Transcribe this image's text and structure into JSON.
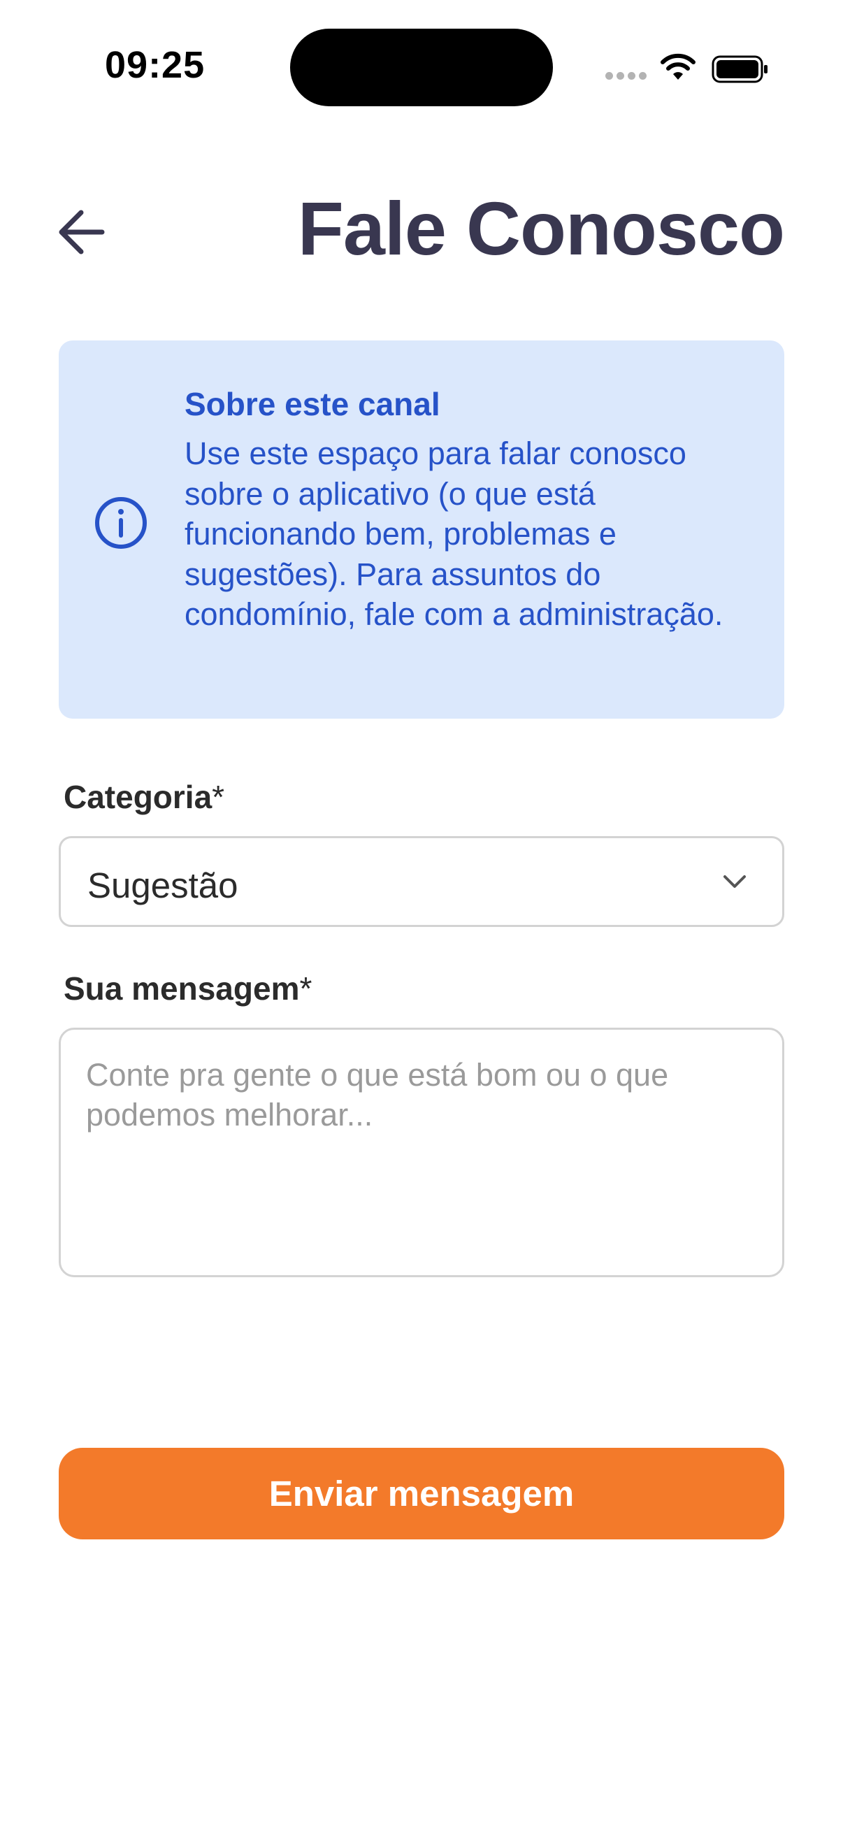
{
  "status_bar": {
    "time": "09:25"
  },
  "header": {
    "back_icon": "arrow-left-icon",
    "title": "Fale Conosco"
  },
  "info_box": {
    "icon": "info-circle-icon",
    "title": "Sobre este canal",
    "text": "Use este espaço para falar conosco sobre o aplicativo (o que está funcionando bem, problemas e sugestões). Para assuntos do condomínio, fale com a administração."
  },
  "form": {
    "category": {
      "label": "Categoria",
      "required_mark": "*",
      "selected_value": "Sugestão"
    },
    "message": {
      "label": "Sua mensagem",
      "required_mark": "*",
      "placeholder": "Conte pra gente o que está bom ou o que podemos melhorar...",
      "value": ""
    },
    "submit_label": "Enviar mensagem"
  },
  "colors": {
    "title": "#393750",
    "info_background": "#dbe8fc",
    "info_text": "#2652c8",
    "primary_button": "#f37a2a",
    "border": "#d3d3d3"
  }
}
